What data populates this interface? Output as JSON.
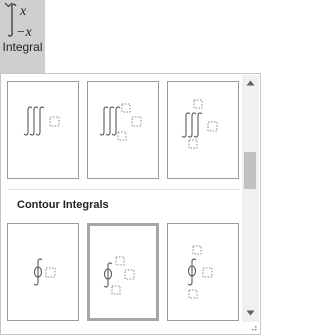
{
  "button": {
    "label": "Integral",
    "icon_upper_limit": "x",
    "icon_lower_limit": "−x"
  },
  "panel": {
    "section_header": "Contour Integrals",
    "rows": [
      {
        "kind": "triple",
        "tiles": [
          "triple-integral",
          "triple-integral-with-limits",
          "triple-integral-stacked-limits"
        ]
      },
      {
        "kind": "contour",
        "tiles": [
          "contour-integral",
          "contour-integral-with-limits",
          "contour-integral-stacked-limits"
        ]
      }
    ],
    "selected_tile": "contour-integral-with-limits"
  },
  "colors": {
    "button_bg": "#cfcfcf",
    "tile_border": "#9a9a9a",
    "selected_border": "#a6a6a6",
    "placeholder": "#8a8a8a",
    "integral_sign": "#5a5a5a"
  }
}
